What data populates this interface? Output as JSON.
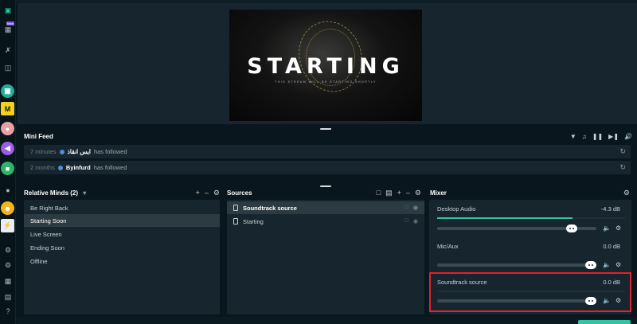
{
  "preview": {
    "title": "STARTING",
    "subtitle": "THIS STREAM WILL BE STARTING SHORTLY"
  },
  "sidebar": {
    "badge": "New",
    "app_letter": "M"
  },
  "minifeed": {
    "title": "Mini Feed",
    "events": [
      {
        "time": "7 minutes",
        "name": "ايس انقاذ",
        "action": "has followed"
      },
      {
        "time": "2 months",
        "name": "Byinfurd",
        "action": "has followed"
      }
    ]
  },
  "scenes": {
    "title": "Relative Minds (2)",
    "items": [
      "Be Right Back",
      "Starting Soon",
      "Live Screen",
      "Ending Soon",
      "Offline"
    ],
    "active": "Starting Soon"
  },
  "sources": {
    "title": "Sources",
    "items": [
      "Soundtrack source",
      "Starting"
    ],
    "active": "Soundtrack source"
  },
  "mixer": {
    "title": "Mixer",
    "channels": [
      {
        "name": "Desktop Audio",
        "db": "-4.3 dB",
        "level": 0.72,
        "volume": 0.87
      },
      {
        "name": "Mic/Aux",
        "db": "0.0 dB",
        "level": 0.0,
        "volume": 1.0
      },
      {
        "name": "Soundtrack source",
        "db": "0.0 dB",
        "level": 0.0,
        "volume": 1.0
      }
    ]
  },
  "colors": {
    "accent": "#31c3a2",
    "highlight": "#e0242b",
    "panel": "#17262e"
  }
}
